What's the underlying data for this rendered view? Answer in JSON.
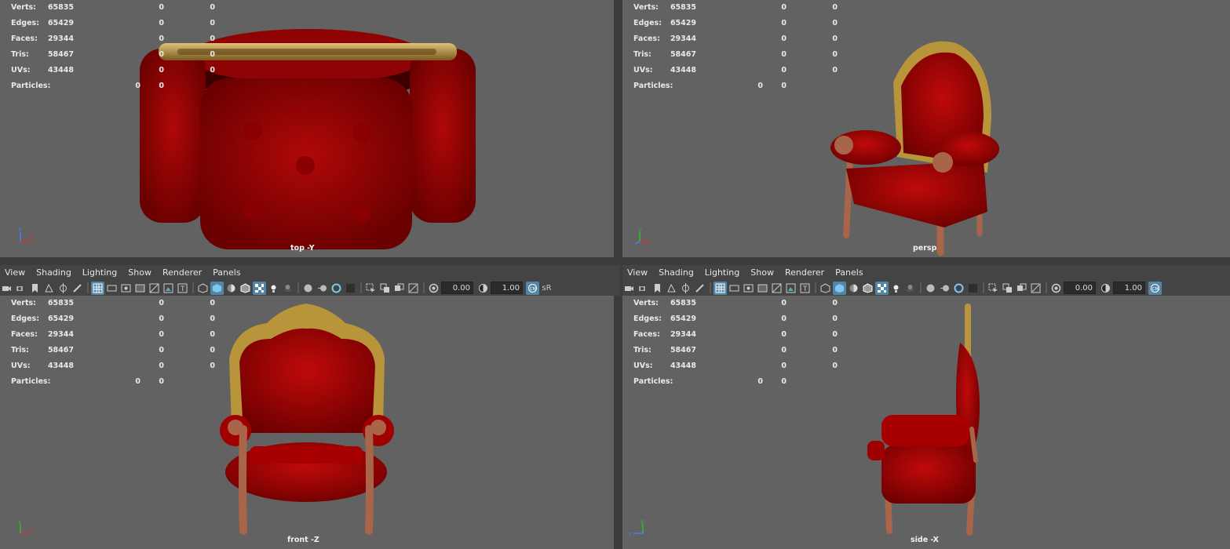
{
  "menu": [
    "View",
    "Shading",
    "Lighting",
    "Show",
    "Renderer",
    "Panels"
  ],
  "stats": {
    "rows": [
      {
        "label": "Verts:",
        "v1": "65835",
        "v2": "0",
        "v3": "0"
      },
      {
        "label": "Edges:",
        "v1": "65429",
        "v2": "0",
        "v3": "0"
      },
      {
        "label": "Faces:",
        "v1": "29344",
        "v2": "0",
        "v3": "0"
      },
      {
        "label": "Tris:",
        "v1": "58467",
        "v2": "0",
        "v3": "0"
      },
      {
        "label": "UVs:",
        "v1": "43448",
        "v2": "0",
        "v3": "0"
      }
    ],
    "particles": {
      "label": "Particles:",
      "v1": "0",
      "v2": "0"
    }
  },
  "toolbar": {
    "exposure": "0.00",
    "gamma": "1.00",
    "colorspace_label": "sR"
  },
  "viewports": {
    "top": {
      "camera": "top -Y"
    },
    "persp": {
      "camera": "persp"
    },
    "front": {
      "camera": "front -Z"
    },
    "side": {
      "camera": "side -X"
    }
  },
  "colors": {
    "viewport_bg": "#626262",
    "panel_bg": "#444444",
    "accent": "#5285a6",
    "velvet": "#a00000",
    "gold": "#b8953a",
    "wood": "#a8654a"
  }
}
